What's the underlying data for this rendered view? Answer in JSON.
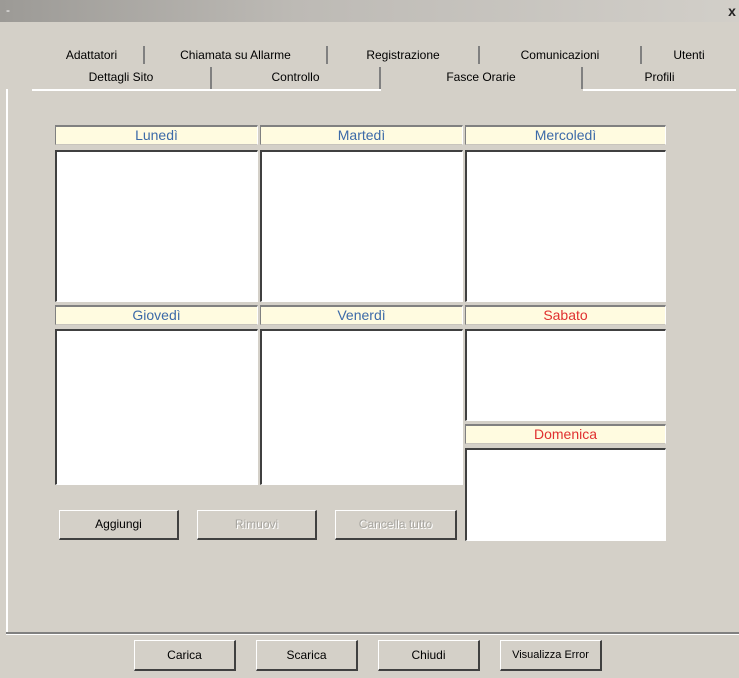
{
  "window": {
    "title_mark": "-",
    "close_label": "x"
  },
  "tabs_row1": [
    "Adattatori",
    "Chiamata su Allarme",
    "Registrazione",
    "Comunicazioni",
    "Utenti"
  ],
  "tabs_row2": [
    "Dettagli Sito",
    "Controllo",
    "Fasce Orarie",
    "Profili"
  ],
  "selected_tab": "Fasce Orarie",
  "days": {
    "mon": "Lunedì",
    "tue": "Martedì",
    "wed": "Mercoledì",
    "thu": "Giovedì",
    "fri": "Venerdì",
    "sat": "Sabato",
    "sun": "Domenica"
  },
  "actions": {
    "add": "Aggiungi",
    "remove": "Rimuovi",
    "clear_all": "Cancella tutto"
  },
  "footer": {
    "load": "Carica",
    "download": "Scarica",
    "close": "Chiudi",
    "view_errors": "Visualizza Error"
  },
  "colors": {
    "weekday_header": "#3c6aa8",
    "weekend_header": "#e03030",
    "header_bg": "#fffbe0"
  }
}
